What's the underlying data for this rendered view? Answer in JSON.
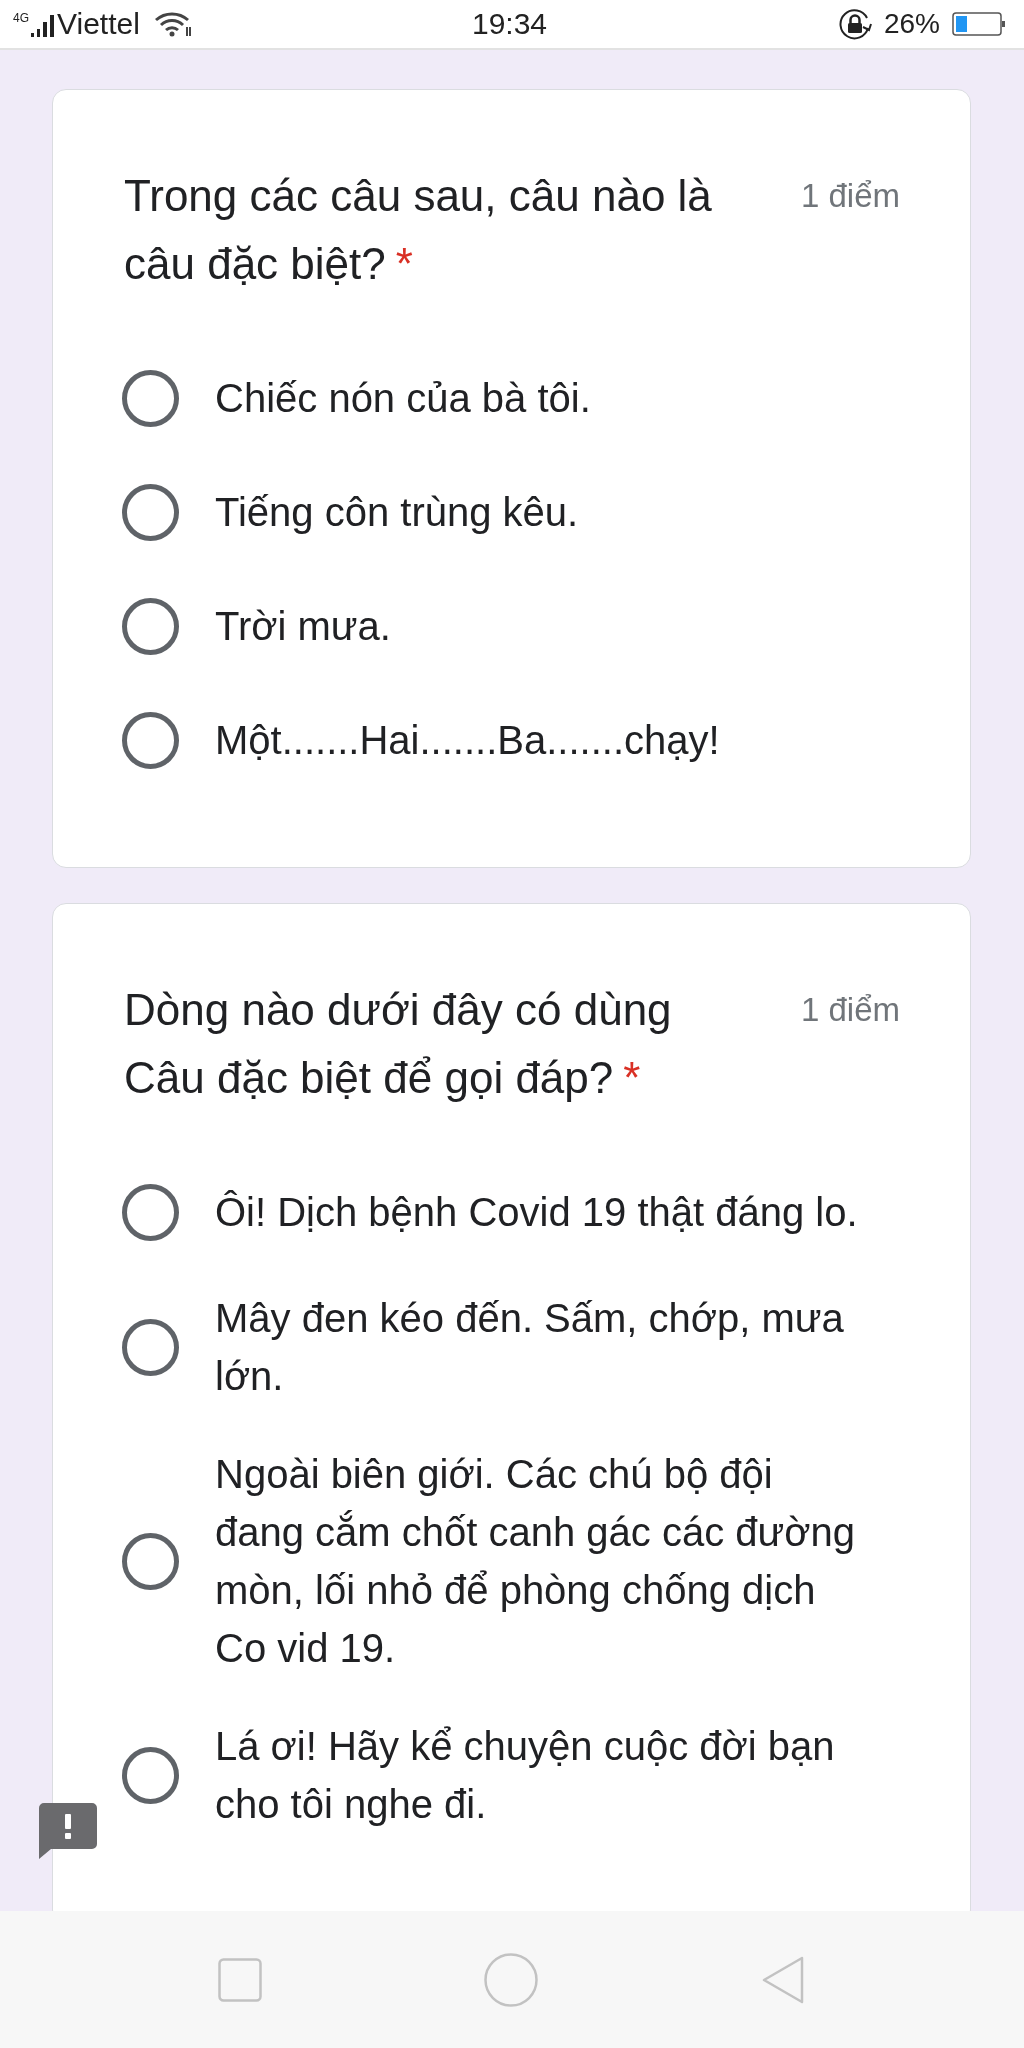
{
  "status_bar": {
    "network": "4G",
    "carrier": "Viettel",
    "time": "19:34",
    "battery": "26%"
  },
  "questions": [
    {
      "title": "Trong các câu sau, câu nào là câu đặc biệt?",
      "required_mark": "*",
      "points": "1 điểm",
      "options": [
        {
          "label": "Chiếc nón của bà tôi.",
          "selected": false
        },
        {
          "label": "Tiếng côn trùng kêu.",
          "selected": false
        },
        {
          "label": "Trời mưa.",
          "selected": false
        },
        {
          "label": "Một.......Hai.......Ba.......chạy!",
          "selected": false
        }
      ]
    },
    {
      "title": "Dòng nào dưới đây có dùng Câu đặc biệt để gọi đáp?",
      "required_mark": "*",
      "points": "1 điểm",
      "options": [
        {
          "label": "Ôi! Dịch bệnh Covid 19 thật đáng lo.",
          "selected": false
        },
        {
          "label": "Mây đen kéo đến. Sấm, chớp, mưa lớn.",
          "selected": false
        },
        {
          "label": "Ngoài biên giới. Các chú bộ đội đang cắm chốt canh gác các đường mòn, lối nhỏ để phòng chống dịch Co vid 19.",
          "selected": false
        },
        {
          "label": "Lá ơi! Hãy kể chuyện cuộc đời bạn cho tôi nghe đi.",
          "selected": false
        }
      ]
    }
  ]
}
